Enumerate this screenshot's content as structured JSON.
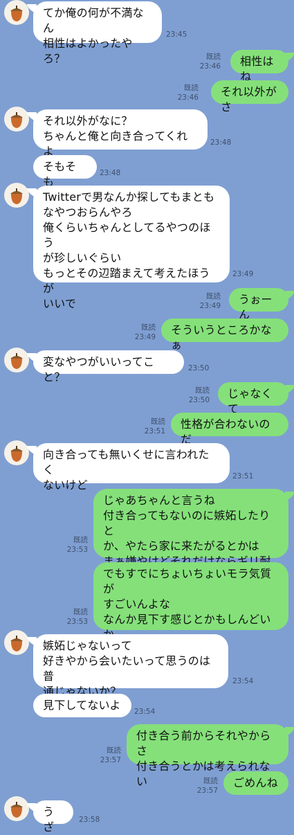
{
  "messages": [
    {
      "side": "in",
      "first": true,
      "text": "てか俺の何が不満なん\n相性はよかったやろ？",
      "time": "23:45"
    },
    {
      "side": "out",
      "first": true,
      "read": "既読",
      "text": "相性はね",
      "time": "23:46"
    },
    {
      "side": "out",
      "first": false,
      "read": "既読",
      "text": "それ以外がさ",
      "time": "23:46"
    },
    {
      "side": "in",
      "first": true,
      "text": "それ以外がなに？\nちゃんと俺と向き合ってくれよ",
      "time": "23:48"
    },
    {
      "side": "in",
      "first": false,
      "text": "そもそも",
      "time": "23:48"
    },
    {
      "side": "in",
      "first": true,
      "text": "Twitterで男なんか探してもまとも\nなやつおらんやろ\n俺くらいちゃんとしてるやつのほう\nが珍しいぐらい\nもっとその辺踏まえて考えたほうが\nいいで",
      "time": "23:49"
    },
    {
      "side": "out",
      "first": true,
      "read": "既読",
      "text": "うぉーん",
      "time": "23:49"
    },
    {
      "side": "out",
      "first": false,
      "read": "既読",
      "text": "そういうところかなぁ",
      "time": "23:49"
    },
    {
      "side": "in",
      "first": true,
      "text": "変なやつがいいってこと？",
      "time": "23:50"
    },
    {
      "side": "out",
      "first": true,
      "read": "既読",
      "text": "じゃなくて",
      "time": "23:50"
    },
    {
      "side": "out",
      "first": false,
      "read": "既読",
      "text": "性格が合わないのだ",
      "time": "23:51"
    },
    {
      "side": "in",
      "first": true,
      "text": "向き合っても無いくせに言われたく\nないけど",
      "time": "23:51"
    },
    {
      "side": "out",
      "first": true,
      "read": "既読",
      "text": "じゃあちゃんと言うね\n付き合ってもないのに嫉妬したりと\nか、やたら家に来たがるとかは\nまぁ嫌やけどそれだけならギリ耐え",
      "time": "23:53"
    },
    {
      "side": "out",
      "first": false,
      "read": "既読",
      "text": "でもすでにちょいちょいモラ気質が\nすごいんよな\nなんか見下す感じとかもしんどいか\nも",
      "time": "23:53"
    },
    {
      "side": "in",
      "first": true,
      "text": "嫉妬じゃないって\n好きやから会いたいって思うのは普\n通じゃないか？",
      "time": "23:54"
    },
    {
      "side": "in",
      "first": false,
      "text": "見下してないよ",
      "time": "23:54"
    },
    {
      "side": "out",
      "first": true,
      "read": "既読",
      "text": "付き合う前からそれやからさ\n付き合うとかは考えられない",
      "time": "23:57"
    },
    {
      "side": "out",
      "first": false,
      "read": "既読",
      "text": "ごめんね",
      "time": "23:57"
    },
    {
      "side": "in",
      "first": true,
      "text": "うざ",
      "time": "23:58"
    }
  ]
}
